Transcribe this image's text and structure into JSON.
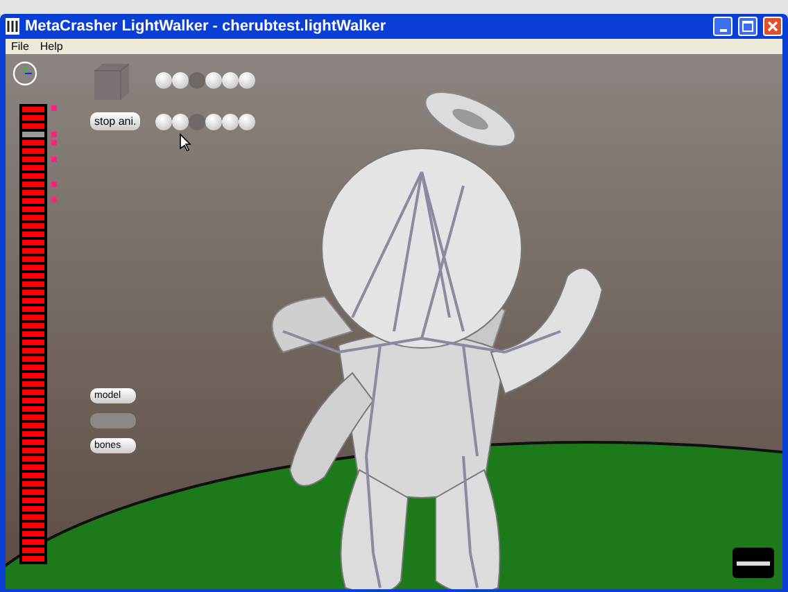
{
  "window": {
    "title": "MetaCrasher LightWalker - cherubtest.lightWalker"
  },
  "menu": [
    {
      "label": "File"
    },
    {
      "label": "Help"
    }
  ],
  "meter": {
    "segments": [
      {
        "on": true
      },
      {
        "on": true
      },
      {
        "on": true
      },
      {
        "on": false
      },
      {
        "on": true
      },
      {
        "on": true
      },
      {
        "on": true
      },
      {
        "on": true
      },
      {
        "on": true
      },
      {
        "on": true
      },
      {
        "on": true
      },
      {
        "on": true
      },
      {
        "on": true
      },
      {
        "on": true
      },
      {
        "on": true
      },
      {
        "on": true
      },
      {
        "on": true
      },
      {
        "on": true
      },
      {
        "on": true
      },
      {
        "on": true
      },
      {
        "on": true
      },
      {
        "on": true
      },
      {
        "on": true
      },
      {
        "on": true
      },
      {
        "on": true
      },
      {
        "on": true
      },
      {
        "on": true
      },
      {
        "on": true
      },
      {
        "on": true
      },
      {
        "on": true
      },
      {
        "on": true
      },
      {
        "on": true
      },
      {
        "on": true
      },
      {
        "on": true
      },
      {
        "on": true
      },
      {
        "on": true
      },
      {
        "on": true
      },
      {
        "on": true
      },
      {
        "on": true
      },
      {
        "on": true
      },
      {
        "on": true
      },
      {
        "on": true
      },
      {
        "on": true
      },
      {
        "on": true
      },
      {
        "on": true
      },
      {
        "on": true
      },
      {
        "on": true
      },
      {
        "on": true
      },
      {
        "on": true
      },
      {
        "on": true
      },
      {
        "on": true
      },
      {
        "on": true
      },
      {
        "on": true
      },
      {
        "on": true
      },
      {
        "on": true
      }
    ]
  },
  "stop_button": {
    "label": "stop ani."
  },
  "dot_rows": [
    [
      {
        "on": true
      },
      {
        "on": true
      },
      {
        "on": false
      },
      {
        "on": true
      },
      {
        "on": true
      },
      {
        "on": true
      }
    ],
    [
      {
        "on": true
      },
      {
        "on": true
      },
      {
        "on": false
      },
      {
        "on": true
      },
      {
        "on": true
      },
      {
        "on": true
      }
    ]
  ],
  "view_buttons": [
    {
      "label": "model",
      "disabled": false
    },
    {
      "disabled": true
    },
    {
      "label": "bones",
      "disabled": false
    }
  ]
}
